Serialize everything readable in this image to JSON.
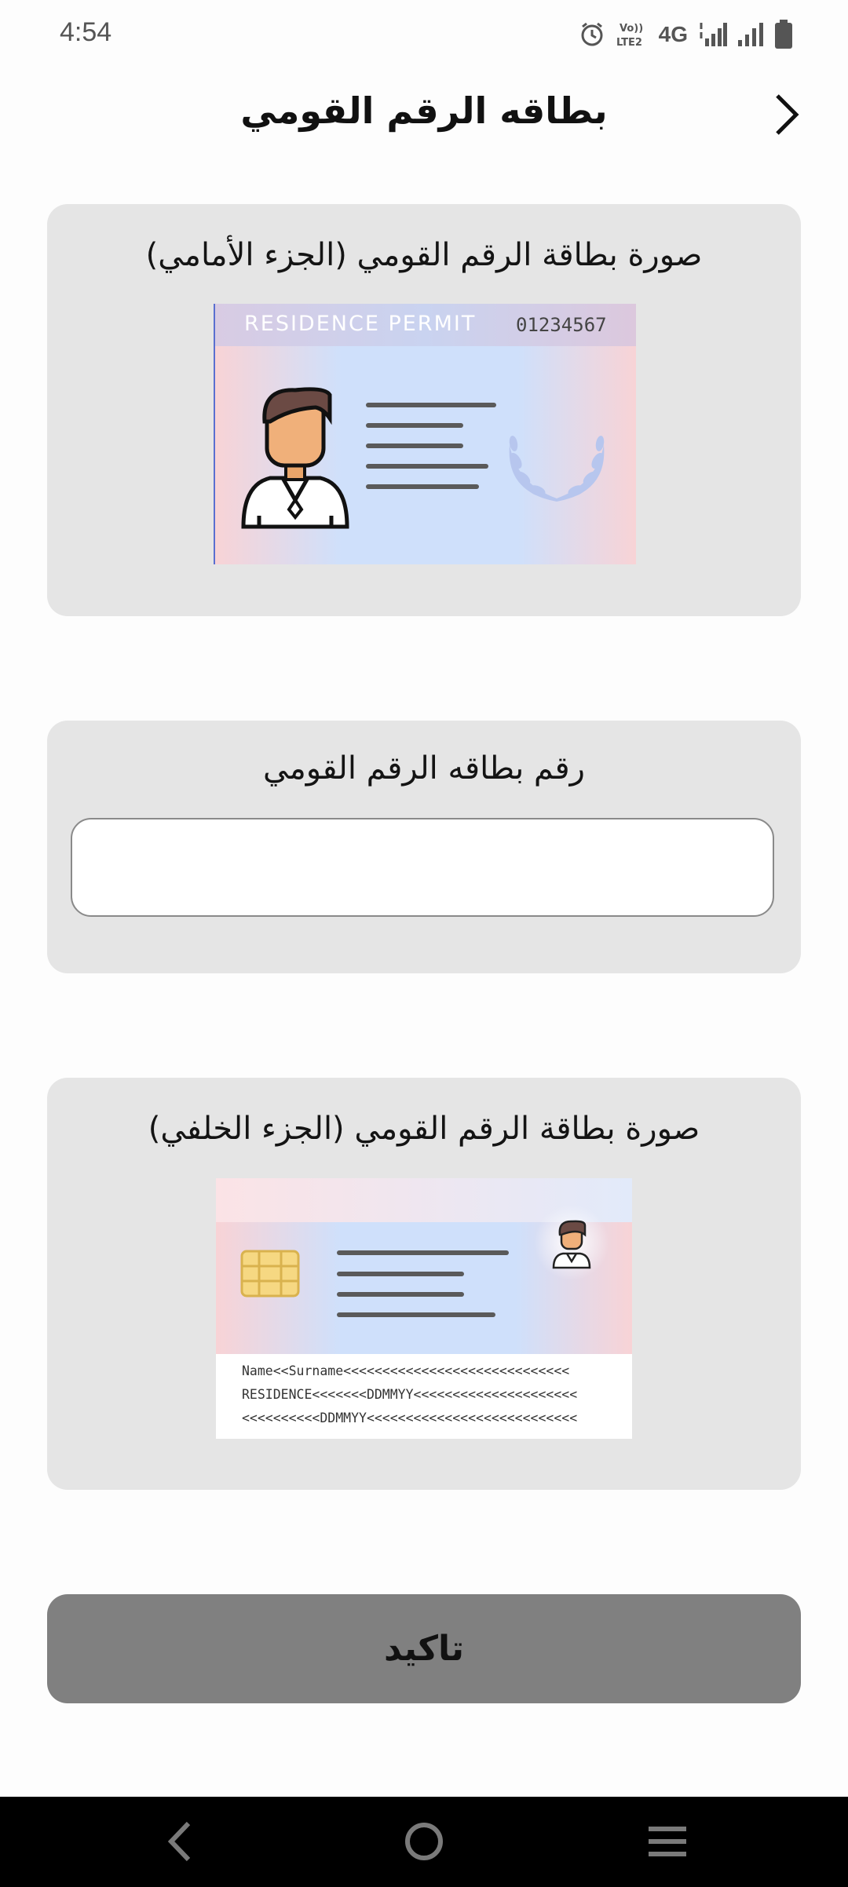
{
  "status_bar": {
    "time": "4:54",
    "icons": [
      "alarm-icon",
      "volte-icon",
      "4g-icon",
      "signal-icon",
      "signal-icon",
      "battery-icon"
    ],
    "network_label": "4G",
    "volte_label": "Vo))",
    "lte_label": "LTE2"
  },
  "header": {
    "title": "بطاقه الرقم القومي",
    "back_icon": "chevron-right-icon"
  },
  "front_section": {
    "title": "صورة بطاقة الرقم القومي (الجزء الأمامي)",
    "card_header_text": "RESIDENCE PERMIT",
    "card_number": "01234567"
  },
  "number_section": {
    "title": "رقم بطاقه الرقم القومي",
    "input_value": "",
    "input_placeholder": ""
  },
  "back_section": {
    "title": "صورة بطاقة الرقم القومي (الجزء الخلفي)",
    "mrz_lines": [
      "Name<<Surname<<<<<<<<<<<<<<<<<<<<<<<<<<<<<",
      "RESIDENCE<<<<<<<DDMMYY<<<<<<<<<<<<<<<<<<<<<",
      "<<<<<<<<<<DDMMYY<<<<<<<<<<<<<<<<<<<<<<<<<<<"
    ]
  },
  "confirm_button": {
    "label": "تاكيد"
  },
  "nav_bar": {
    "items": [
      "back-nav-icon",
      "home-nav-icon",
      "recents-nav-icon"
    ]
  },
  "colors": {
    "card_bg": "#e5e5e5",
    "button_bg": "#808080",
    "nav_bg": "#000000",
    "id_blue": "#cfe0fb",
    "id_pink": "#f8d3d6"
  }
}
